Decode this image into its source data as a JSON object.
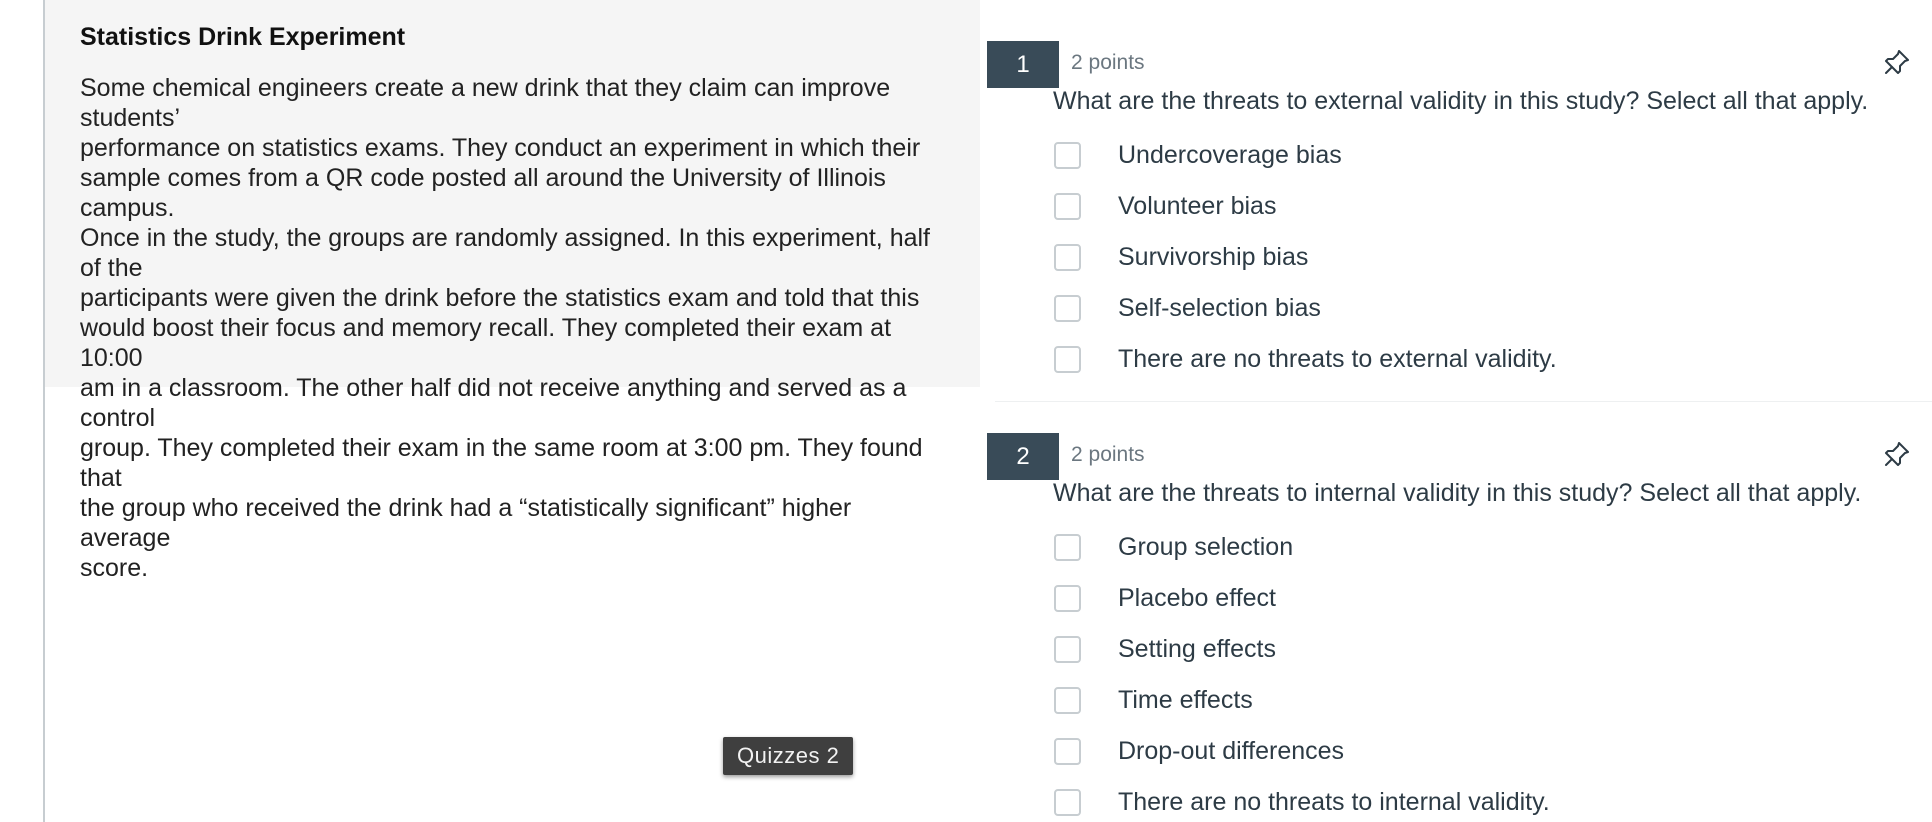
{
  "stimulus": {
    "title": "Statistics Drink Experiment",
    "lines": [
      "Some chemical engineers create a new drink that they claim can improve students’",
      "performance on statistics exams. They conduct an experiment in which their",
      "sample comes from a QR code posted all around the University of Illinois campus.",
      "Once in the study, the groups are randomly assigned. In this experiment, half of the",
      "participants were given the drink before the statistics exam and told that this",
      "would boost their focus and memory recall. They completed their exam at 10:00",
      "am in a classroom. The other half did not receive anything and served as a control",
      "group. They completed their exam in the same room at 3:00 pm. They found that",
      "the group who received the drink had a “statistically significant” higher average",
      "score."
    ]
  },
  "questions": [
    {
      "number": "1",
      "points": "2 points",
      "text": "What are the threats to external validity in this study? Select all that apply.",
      "options": [
        "Undercoverage bias",
        "Volunteer bias",
        "Survivorship bias",
        "Self-selection bias",
        "There are no threats to external validity."
      ]
    },
    {
      "number": "2",
      "points": "2 points",
      "text": "What are the threats to internal validity in this study? Select all that apply.",
      "options": [
        "Group selection",
        "Placebo effect",
        "Setting effects",
        "Time effects",
        "Drop-out differences",
        "There are no threats to internal validity."
      ]
    }
  ],
  "tooltip": {
    "label": "Quizzes 2"
  },
  "icons": {
    "pin": "pin-icon",
    "checkbox": "checkbox-unchecked"
  },
  "colors": {
    "number_badge": "#394b58",
    "stimulus_bg": "#f5f5f5",
    "text": "#2d3b45",
    "muted": "#6b7780",
    "checkbox_border": "#c7cdd1",
    "tooltip_bg": "#3f3f3f"
  }
}
